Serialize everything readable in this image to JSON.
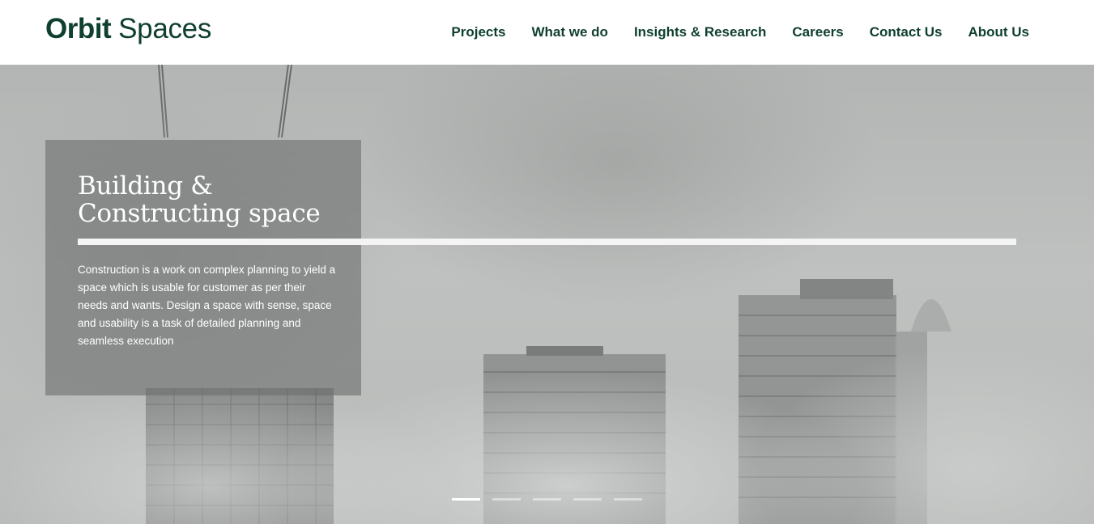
{
  "brand": {
    "name_bold": "Orbit",
    "name_light": "Spaces",
    "color": "#0f3f2e"
  },
  "nav": [
    {
      "label": "Projects"
    },
    {
      "label": "What we do"
    },
    {
      "label": "Insights & Research"
    },
    {
      "label": "Careers"
    },
    {
      "label": "Contact Us"
    },
    {
      "label": "About Us"
    }
  ],
  "hero": {
    "title": "Building & Constructing space",
    "body": "Construction is a work on complex planning to yield a space which is usable for customer as per their needs and wants. Design a space with sense, space and usability is a task of detailed planning and seamless execution",
    "slides_total": 5,
    "active_slide": 1
  }
}
